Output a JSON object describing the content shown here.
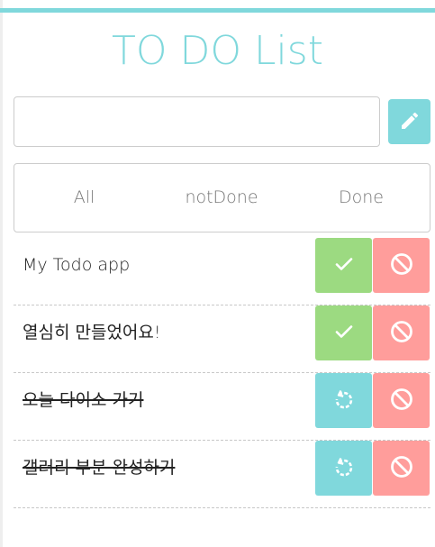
{
  "app": {
    "title": "TO DO List"
  },
  "input": {
    "value": "",
    "placeholder": ""
  },
  "filters": {
    "all": "All",
    "notdone": "notDone",
    "done": "Done"
  },
  "todos": [
    {
      "text": "My Todo app",
      "done": false,
      "action_icon": "check-icon",
      "delete_icon": "block-icon"
    },
    {
      "text": "열심히 만들었어요!",
      "done": false,
      "action_icon": "check-icon",
      "delete_icon": "block-icon"
    },
    {
      "text": "오늘 다이소 가기",
      "done": true,
      "action_icon": "undo-icon",
      "delete_icon": "block-icon"
    },
    {
      "text": "갤러리 부분 완성하기",
      "done": true,
      "action_icon": "undo-icon",
      "delete_icon": "block-icon"
    }
  ],
  "colors": {
    "accent": "#80d8dc",
    "check": "#9cda81",
    "delete": "#ff9d9b"
  },
  "icons": {
    "add": "pencil-icon"
  }
}
